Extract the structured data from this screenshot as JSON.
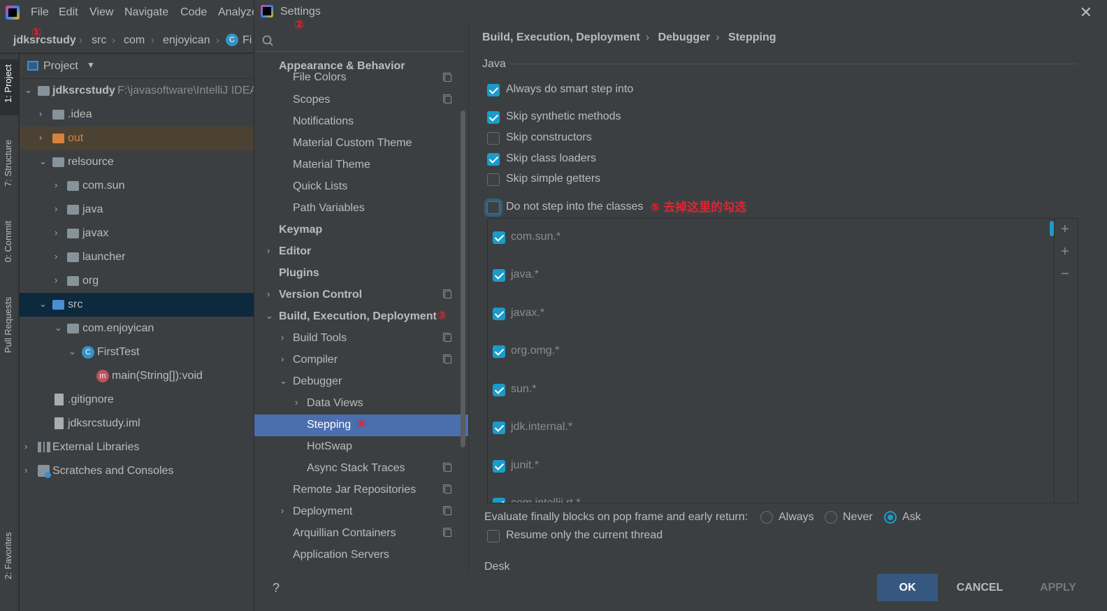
{
  "ide": {
    "menu": [
      "File",
      "Edit",
      "View",
      "Navigate",
      "Code",
      "Analyze"
    ],
    "breadcrumbs": [
      "jdksrcstudy",
      "src",
      "com",
      "enjoyican",
      "Fi"
    ],
    "marker1": "①",
    "side_tabs": [
      "1: Project",
      "7: Structure",
      "0: Commit",
      "Pull Requests",
      "2: Favorites"
    ],
    "project_header": "Project",
    "tree": [
      {
        "label": "jdksrcstudy",
        "sub": "F:\\javasoftware\\IntelliJ IDEA"
      },
      {
        "label": ".idea"
      },
      {
        "label": "out"
      },
      {
        "label": "relsource"
      },
      {
        "label": "com.sun"
      },
      {
        "label": "java"
      },
      {
        "label": "javax"
      },
      {
        "label": "launcher"
      },
      {
        "label": "org"
      },
      {
        "label": "src"
      },
      {
        "label": "com.enjoyican"
      },
      {
        "label": "FirstTest"
      },
      {
        "label": "main(String[]):void"
      },
      {
        "label": ".gitignore"
      },
      {
        "label": "jdksrcstudy.iml"
      },
      {
        "label": "External Libraries"
      },
      {
        "label": "Scratches and Consoles"
      }
    ]
  },
  "dialog": {
    "title": "Settings",
    "marker2": "②",
    "nav": [
      {
        "label": "Appearance & Behavior"
      },
      {
        "label": "File Colors"
      },
      {
        "label": "Scopes"
      },
      {
        "label": "Notifications"
      },
      {
        "label": "Material Custom Theme"
      },
      {
        "label": "Material Theme"
      },
      {
        "label": "Quick Lists"
      },
      {
        "label": "Path Variables"
      },
      {
        "label": "Keymap"
      },
      {
        "label": "Editor"
      },
      {
        "label": "Plugins"
      },
      {
        "label": "Version Control"
      },
      {
        "label": "Build, Execution, Deployment"
      },
      {
        "label": "Build Tools"
      },
      {
        "label": "Compiler"
      },
      {
        "label": "Debugger"
      },
      {
        "label": "Data Views"
      },
      {
        "label": "Stepping"
      },
      {
        "label": "HotSwap"
      },
      {
        "label": "Async Stack Traces"
      },
      {
        "label": "Remote Jar Repositories"
      },
      {
        "label": "Deployment"
      },
      {
        "label": "Arquillian Containers"
      },
      {
        "label": "Application Servers"
      }
    ],
    "marker3": "③",
    "marker4": "④",
    "breadcrumb": [
      "Build, Execution, Deployment",
      "Debugger",
      "Stepping"
    ],
    "section_java": "Java",
    "options": [
      {
        "label": "Always do smart step into",
        "checked": true
      },
      {
        "label": "Skip synthetic methods",
        "checked": true
      },
      {
        "label": "Skip constructors",
        "checked": false
      },
      {
        "label": "Skip class loaders",
        "checked": true
      },
      {
        "label": "Skip simple getters",
        "checked": false
      },
      {
        "label": "Do not step into the classes",
        "checked": false
      }
    ],
    "annotation5": "⑤ 去掉这里的勾选",
    "classes": [
      {
        "label": "com.sun.*",
        "checked": true
      },
      {
        "label": "java.*",
        "checked": true
      },
      {
        "label": "javax.*",
        "checked": true
      },
      {
        "label": "org.omg.*",
        "checked": true
      },
      {
        "label": "sun.*",
        "checked": true
      },
      {
        "label": "jdk.internal.*",
        "checked": true
      },
      {
        "label": "junit.*",
        "checked": true
      },
      {
        "label": "com.intellij.rt.*",
        "checked": true
      }
    ],
    "finally_label": "Evaluate finally blocks on pop frame and early return:",
    "radios": [
      {
        "label": "Always",
        "selected": false
      },
      {
        "label": "Never",
        "selected": false
      },
      {
        "label": "Ask",
        "selected": true
      }
    ],
    "resume_label": "Resume only the current thread",
    "resume_checked": false,
    "partial_text": "Desk",
    "buttons": {
      "help": "?",
      "ok": "OK",
      "cancel": "CANCEL",
      "apply": "APPLY"
    },
    "colors": {
      "selection": "#4b6eaf",
      "checkbox": "#1b9bc9",
      "ok_button": "#365880",
      "annotation": "#e8212f"
    }
  }
}
